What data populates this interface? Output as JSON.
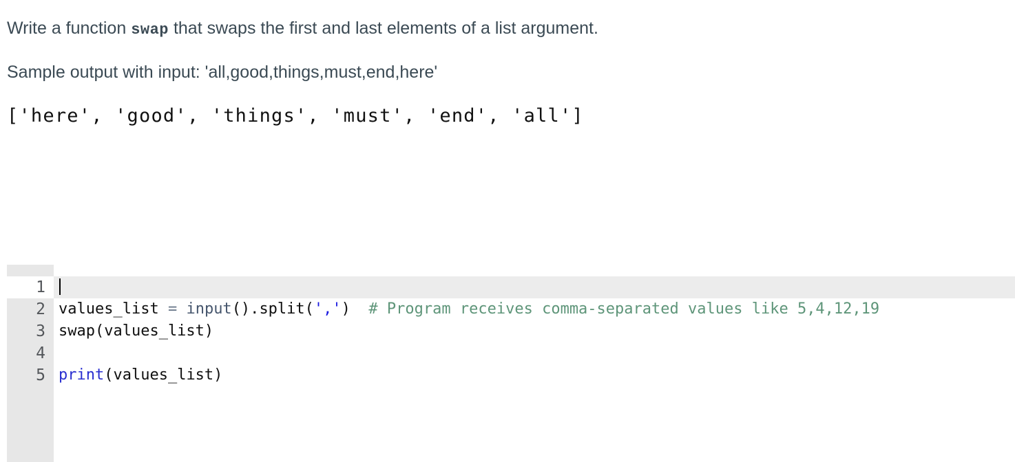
{
  "prompt": {
    "line1_before": "Write a function ",
    "line1_code": "swap",
    "line1_after": " that swaps the first and last elements of a list argument.",
    "line2": "Sample output with input: 'all,good,things,must,end,here'",
    "sample_output": "['here', 'good', 'things', 'must', 'end', 'all']"
  },
  "editor": {
    "language": "python",
    "active_line": 1,
    "cursor_line": 1,
    "cursor_column": 1,
    "line_numbers": [
      "1",
      "2",
      "3",
      "4",
      "5"
    ],
    "lines": [
      {
        "number": "1",
        "text": "",
        "tokens": []
      },
      {
        "number": "2",
        "text": "values_list = input().split(',')  # Program receives comma-separated values like 5,4,12,19",
        "tokens": [
          {
            "t": "values_list ",
            "c": "plain"
          },
          {
            "t": "=",
            "c": "op"
          },
          {
            "t": " ",
            "c": "plain"
          },
          {
            "t": "input",
            "c": "func"
          },
          {
            "t": "().",
            "c": "plain"
          },
          {
            "t": "split",
            "c": "plain"
          },
          {
            "t": "(",
            "c": "plain"
          },
          {
            "t": "','",
            "c": "string"
          },
          {
            "t": ")  ",
            "c": "plain"
          },
          {
            "t": "# Program receives comma-separated values like 5,4,12,19",
            "c": "comment"
          }
        ]
      },
      {
        "number": "3",
        "text": "swap(values_list)",
        "tokens": [
          {
            "t": "swap(values_list)",
            "c": "plain"
          }
        ]
      },
      {
        "number": "4",
        "text": "",
        "tokens": []
      },
      {
        "number": "5",
        "text": "print(values_list)",
        "tokens": [
          {
            "t": "print",
            "c": "builtin"
          },
          {
            "t": "(values_list)",
            "c": "plain"
          }
        ]
      }
    ]
  },
  "colors": {
    "text": "#3b4a54",
    "gutter_bg": "#e7e7e7",
    "active_line_bg": "#ececec",
    "comment": "#5e9579",
    "string": "#1a1ae0",
    "builtin": "#2a2fd0",
    "function": "#46566d",
    "operator": "#6c7a8c"
  }
}
